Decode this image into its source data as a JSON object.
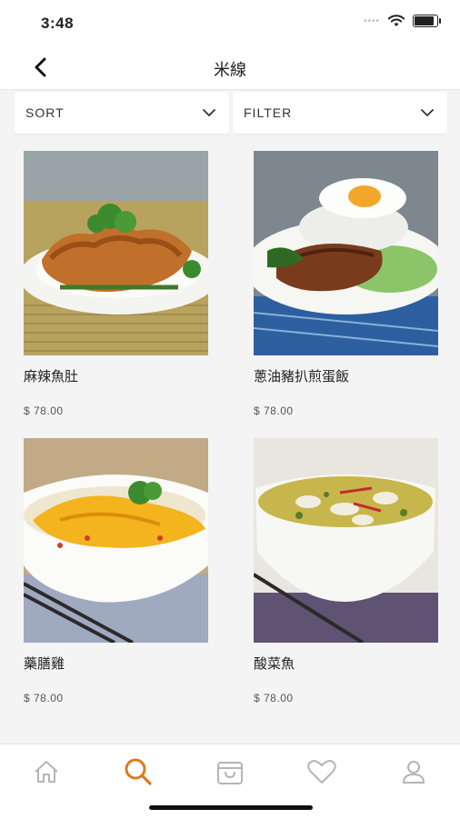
{
  "status": {
    "time": "3:48"
  },
  "nav": {
    "title": "米線"
  },
  "controls": {
    "sort_label": "SORT",
    "filter_label": "FILTER"
  },
  "products": [
    {
      "name": "麻辣魚肚",
      "price": "$ 78.00"
    },
    {
      "name": "蔥油豬扒煎蛋飯",
      "price": "$ 78.00"
    },
    {
      "name": "藥膳雞",
      "price": "$ 78.00"
    },
    {
      "name": "酸菜魚",
      "price": "$ 78.00"
    }
  ],
  "tabs": [
    {
      "icon": "home-icon"
    },
    {
      "icon": "search-icon",
      "active": true
    },
    {
      "icon": "shopping-bag-icon"
    },
    {
      "icon": "heart-icon"
    },
    {
      "icon": "profile-icon"
    }
  ],
  "colors": {
    "accent": "#e07a1f",
    "inactive_icon": "#b5b5b5"
  }
}
